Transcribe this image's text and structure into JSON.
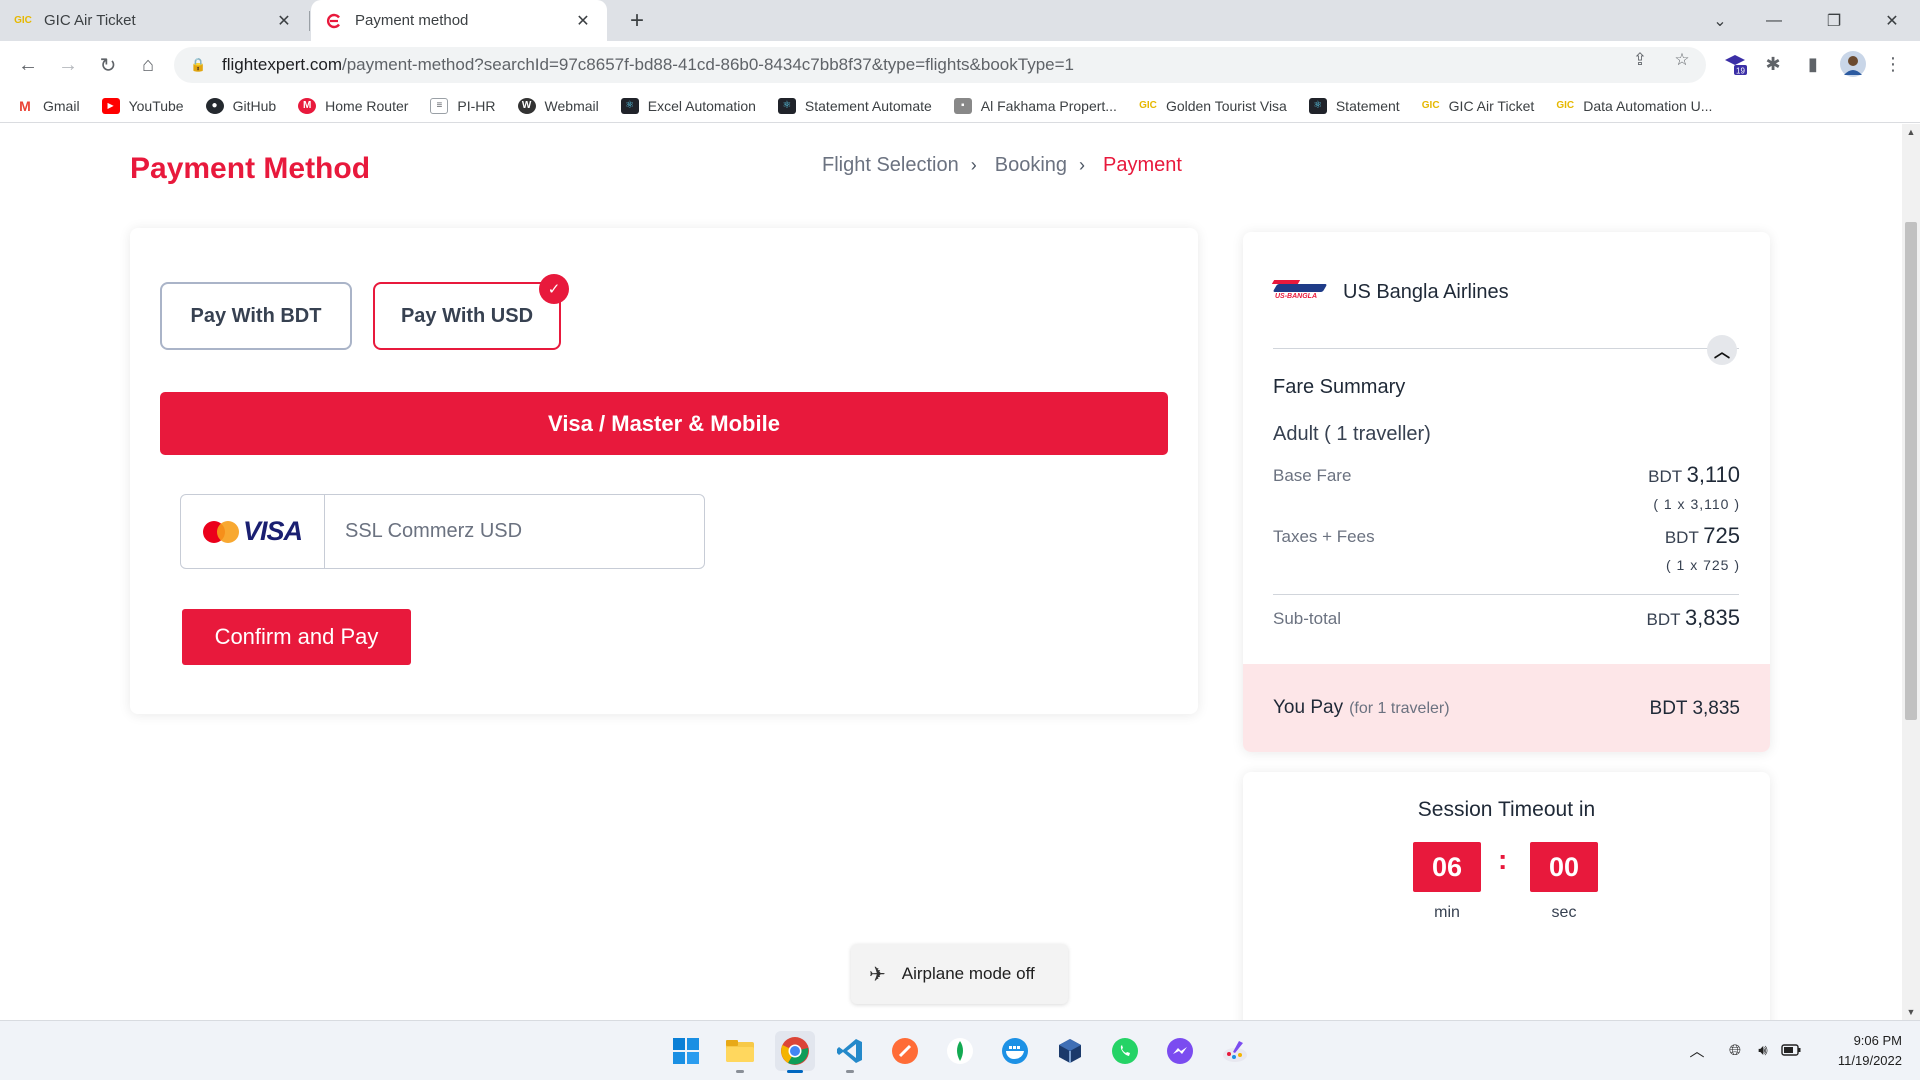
{
  "browser": {
    "tabs": [
      {
        "title": "GIC Air Ticket",
        "active": false
      },
      {
        "title": "Payment method",
        "active": true
      }
    ],
    "url_host": "flightexpert.com",
    "url_path": "/payment-method?searchId=97c8657f-bd88-41cd-86b0-8434c7bb8f37&type=flights&bookType=1",
    "extension_badge": "19",
    "bookmarks": [
      "Gmail",
      "YouTube",
      "GitHub",
      "Home Router",
      "PI-HR",
      "Webmail",
      "Excel Automation",
      "Statement Automate",
      "Al Fakhama Propert...",
      "Golden Tourist Visa",
      "Statement",
      "GIC Air Ticket",
      "Data Automation U..."
    ]
  },
  "page": {
    "title": "Payment Method",
    "steps": [
      "Flight Selection",
      "Booking",
      "Payment"
    ],
    "currency_options": [
      "Pay With BDT",
      "Pay With USD"
    ],
    "selected_currency": "Pay With USD",
    "method_tab": "Visa / Master & Mobile",
    "gateway_logo_text": "VISA",
    "gateway_name": "SSL Commerz USD",
    "confirm_label": "Confirm and Pay"
  },
  "fare": {
    "airline": "US Bangla Airlines",
    "airline_logo_text": "US-BANGLA",
    "summary_title": "Fare Summary",
    "passenger_line": "Adult ( 1 traveller)",
    "base_fare_label": "Base Fare",
    "base_fare_currency": "BDT",
    "base_fare_amount": "3,110",
    "base_fare_breakdown": "( 1 x 3,110 )",
    "taxes_label": "Taxes + Fees",
    "taxes_currency": "BDT",
    "taxes_amount": "725",
    "taxes_breakdown": "( 1 x 725 )",
    "subtotal_label": "Sub-total",
    "subtotal_currency": "BDT",
    "subtotal_amount": "3,835",
    "you_pay_label": "You Pay",
    "you_pay_note": "(for 1 traveler)",
    "you_pay_amount": "BDT 3,835"
  },
  "timer": {
    "title": "Session Timeout in",
    "minutes": "06",
    "seconds": "00",
    "separator": ":",
    "min_label": "min",
    "sec_label": "sec"
  },
  "toast": {
    "text": "Airplane mode off"
  },
  "taskbar": {
    "time": "9:06 PM",
    "date": "11/19/2022"
  },
  "colors": {
    "brand_red": "#e8193c",
    "you_pay_bg": "#fde6e8"
  }
}
